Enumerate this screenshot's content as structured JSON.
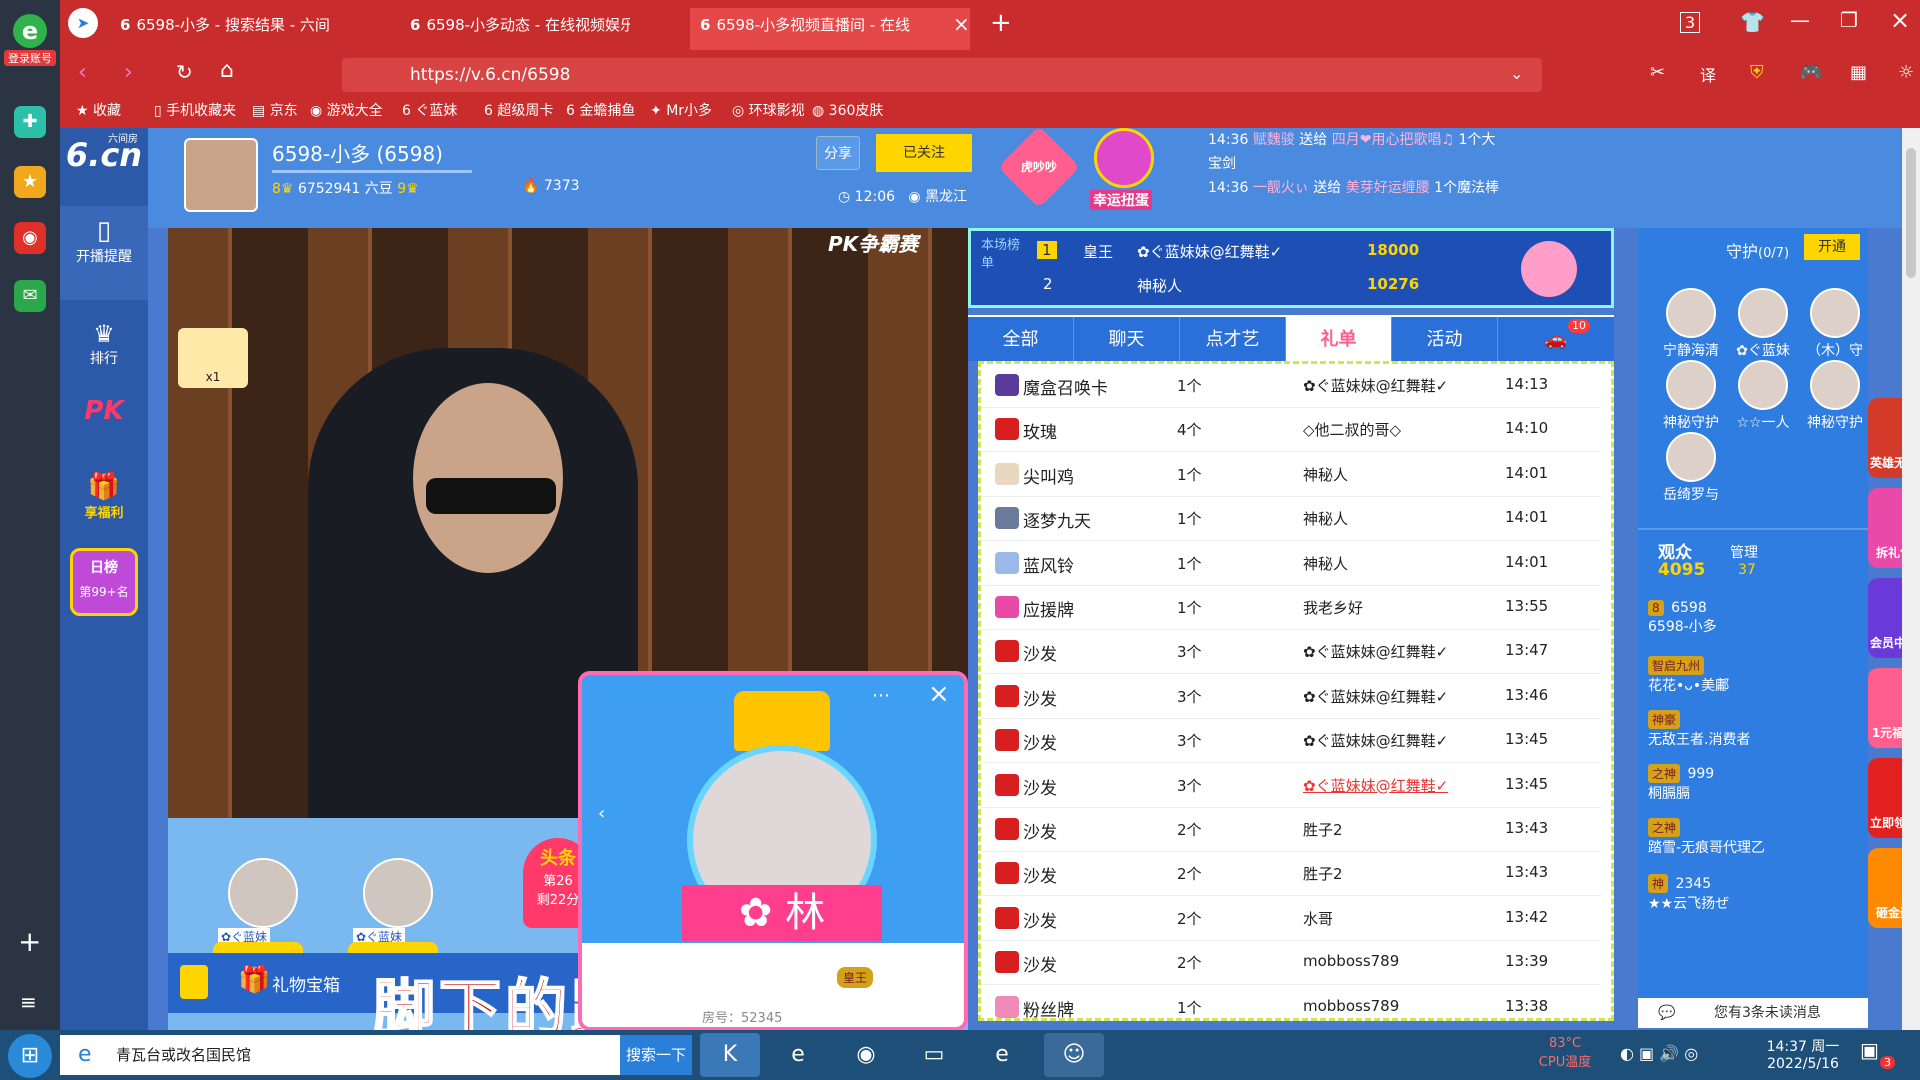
{
  "browser": {
    "tabs": [
      {
        "label": "6598-小多 - 搜索结果 - 六间"
      },
      {
        "label": "6598-小多动态 - 在线视频娱乐"
      },
      {
        "label": "6598-小多视频直播间 - 在线"
      }
    ],
    "url": "https://v.6.cn/6598",
    "bookmarks": [
      "收藏",
      "手机收藏夹",
      "京东",
      "游戏大全",
      "ぐ蓝妹",
      "超级周卡",
      "金蟾捕鱼",
      "Mr小多",
      "环球影视",
      "360皮肤"
    ]
  },
  "appbar": {
    "login_label": "登录账号"
  },
  "leftnav": {
    "logo": "6.cn",
    "logo_sub": "六间房",
    "start_label": "开播提醒",
    "rank_label": "排行",
    "pk_label": "PK",
    "fuli_label": "享福利",
    "daily_label": "日榜",
    "daily_rank": "第99+名"
  },
  "header": {
    "anchor_name": "6598-小多 (6598)",
    "beans": "6752941 六豆",
    "fire": "7373",
    "share": "分享",
    "follow": "已关注",
    "time": "12:06",
    "location": "黑龙江",
    "lucky": "幸运扭蛋",
    "heart_label": "虎吵吵",
    "ticker": [
      {
        "time": "14:36",
        "user": "赋魏骏",
        "verb": "送给",
        "target": "四月❤用心把歌唱♫",
        "gift": "1个大宝剑"
      },
      {
        "time": "14:36",
        "user": "一靓火ぃ",
        "verb": "送给",
        "target": "美芽好运缠腰",
        "gift": "1个魔法棒"
      }
    ]
  },
  "video": {
    "pk_badge": "PK争霸赛",
    "guard_count": "x1",
    "lyric": "脚下的路在蔓延",
    "gift_box": "礼物宝箱",
    "car_users": [
      "✿ぐ蓝妹",
      "✿ぐ蓝妹"
    ],
    "headline": "头条",
    "headline_sub": "第26",
    "headline_sub2": "剩22分",
    "popup_band": "✿ 林",
    "popup_room": "房号：52345",
    "popup_badge": "皇王"
  },
  "rank": {
    "title": "本场榜单",
    "rows": [
      {
        "pos": "1",
        "badge": "皇王",
        "name": "✿ぐ蓝妹妹@红舞鞋✓",
        "score": "18000"
      },
      {
        "pos": "2",
        "badge": "",
        "name": "神秘人",
        "score": "10276"
      }
    ]
  },
  "tabs": {
    "items": [
      "全部",
      "聊天",
      "点才艺",
      "礼单",
      "活动"
    ],
    "car_count": "10"
  },
  "gifts": [
    {
      "gift": "魔盒召唤卡",
      "count": "1个",
      "user": "✿ぐ蓝妹妹@红舞鞋✓",
      "time": "14:13",
      "color": "#5a3a9a"
    },
    {
      "gift": "玫瑰",
      "count": "4个",
      "user": "◇他二叔的哥◇",
      "time": "14:10",
      "color": "#d81e1e"
    },
    {
      "gift": "尖叫鸡",
      "count": "1个",
      "user": "神秘人",
      "time": "14:01",
      "color": "#e8d8c0"
    },
    {
      "gift": "逐梦九天",
      "count": "1个",
      "user": "神秘人",
      "time": "14:01",
      "color": "#6a7a9a"
    },
    {
      "gift": "蓝风铃",
      "count": "1个",
      "user": "神秘人",
      "time": "14:01",
      "color": "#9ab8e8"
    },
    {
      "gift": "应援牌",
      "count": "1个",
      "user": "我老乡好",
      "time": "13:55",
      "color": "#e84aa8"
    },
    {
      "gift": "沙发",
      "count": "3个",
      "user": "✿ぐ蓝妹妹@红舞鞋✓",
      "time": "13:47",
      "color": "#d81e1e"
    },
    {
      "gift": "沙发",
      "count": "3个",
      "user": "✿ぐ蓝妹妹@红舞鞋✓",
      "time": "13:46",
      "color": "#d81e1e"
    },
    {
      "gift": "沙发",
      "count": "3个",
      "user": "✿ぐ蓝妹妹@红舞鞋✓",
      "time": "13:45",
      "color": "#d81e1e"
    },
    {
      "gift": "沙发",
      "count": "3个",
      "user": "✿ぐ蓝妹妹@红舞鞋✓",
      "time": "13:45",
      "color": "#d81e1e",
      "highlight": true
    },
    {
      "gift": "沙发",
      "count": "2个",
      "user": "胜子2",
      "time": "13:43",
      "color": "#d81e1e"
    },
    {
      "gift": "沙发",
      "count": "2个",
      "user": "胜子2",
      "time": "13:43",
      "color": "#d81e1e"
    },
    {
      "gift": "沙发",
      "count": "2个",
      "user": "水哥",
      "time": "13:42",
      "color": "#d81e1e"
    },
    {
      "gift": "沙发",
      "count": "2个",
      "user": "mobboss789",
      "time": "13:39",
      "color": "#d81e1e"
    },
    {
      "gift": "粉丝牌",
      "count": "1个",
      "user": "mobboss789",
      "time": "13:38",
      "color": "#f08ab8"
    }
  ],
  "guard": {
    "title": "守护",
    "count": "(0/7)",
    "open": "开通",
    "members": [
      "宁静海清",
      "✿ぐ蓝妹",
      "（木）守",
      "神秘守护",
      "☆☆一人",
      "神秘守护",
      "岳绮罗与"
    ]
  },
  "audience": {
    "label": "观众",
    "count": "4095",
    "manage": "管理",
    "manage_count": "37",
    "users": [
      {
        "name": "6598-小多",
        "badge": "8",
        "extra": "6598"
      },
      {
        "name": "花花•ᴗ•美鄘",
        "badge": "智启九州"
      },
      {
        "name": "无敌王者.消费者",
        "badge": "神豪"
      },
      {
        "name": "桐膈膈",
        "badge": "之神",
        "extra": "999"
      },
      {
        "name": "踏雪-无痕哥代理乙",
        "badge": "之神"
      },
      {
        "name": "★★云飞扬ぜ",
        "badge": "神",
        "extra": "2345"
      }
    ],
    "unread": "您有3条未读消息"
  },
  "promo": [
    "英雄无双",
    "拆礼包",
    "会员中心",
    "1元福利",
    "立即领取",
    "砸金蛋"
  ],
  "taskbar": {
    "search_text": "青瓦台或改名国民馆",
    "search_btn": "搜索一下",
    "cpu": "83°C",
    "cpu_label": "CPU温度",
    "time": "14:37 周一",
    "date": "2022/5/16",
    "badge": "3"
  },
  "colors": {
    "accent": "#ffd500",
    "tab_bar": "#c92c2c",
    "highlight": "#ff5e8e"
  }
}
